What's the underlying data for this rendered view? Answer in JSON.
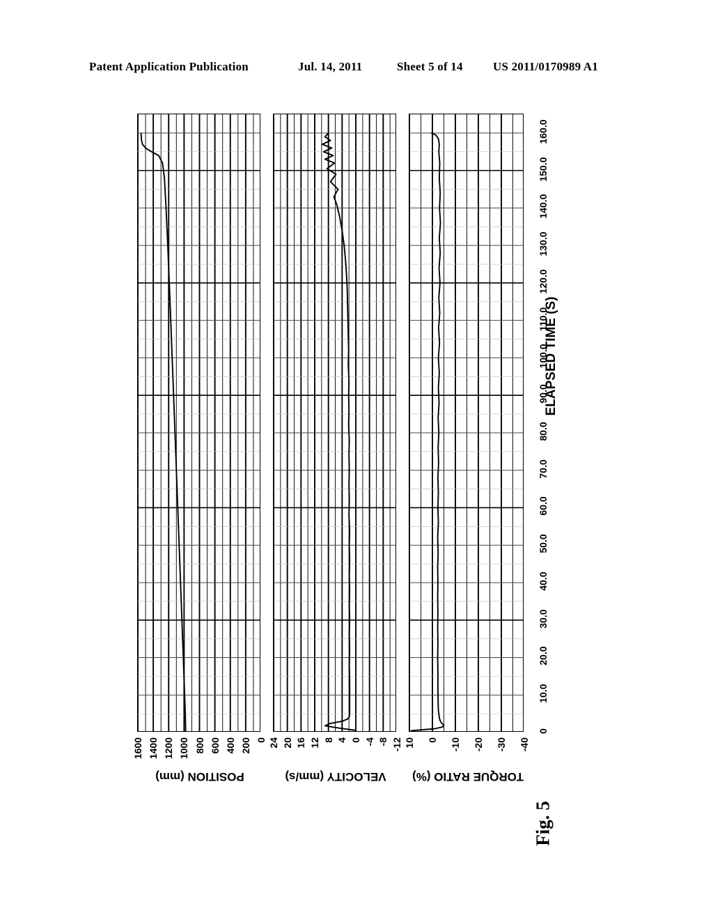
{
  "header": {
    "publication": "Patent Application Publication",
    "date": "Jul. 14, 2011",
    "sheet": "Sheet 5 of 14",
    "number": "US 2011/0170989 A1"
  },
  "figure": {
    "caption": "Fig. 5",
    "time_axis_title": "ELAPSED TIME (S)",
    "time_ticks": [
      "0",
      "10.0",
      "20.0",
      "30.0",
      "40.0",
      "50.0",
      "60.0",
      "70.0",
      "80.0",
      "90.0",
      "100.0",
      "110.0",
      "120.0",
      "130.0",
      "140.0",
      "150.0",
      "160.0"
    ]
  },
  "chart_data": [
    {
      "type": "line",
      "name": "position",
      "title": "POSITION (mm)",
      "xlabel": "ELAPSED TIME (S)",
      "ylabel": "POSITION (mm)",
      "orientation": "rotated-90",
      "grid": true,
      "xlim": [
        0,
        165
      ],
      "ylim": [
        0,
        1600
      ],
      "ytick_labels": [
        "1600",
        "1400",
        "1200",
        "1000",
        "800",
        "600",
        "400",
        "200",
        "0"
      ],
      "yticks": [
        1600,
        1400,
        1200,
        1000,
        800,
        600,
        400,
        200,
        0
      ],
      "minor_divisions_per_major": 2,
      "series": [
        {
          "name": "POSITION",
          "x": [
            0,
            1.0,
            2.0,
            3.0,
            4.0,
            6.0,
            10.0,
            20.0,
            30.0,
            40.0,
            50.0,
            60.0,
            70.0,
            80.0,
            90.0,
            100.0,
            110.0,
            120.0,
            130.0,
            140.0,
            148.0,
            152.0,
            154.0,
            155.0,
            156.0,
            157.0,
            158.0,
            159.0,
            160.0
          ],
          "y": [
            980,
            980,
            981,
            982,
            983,
            986,
            993,
            1010,
            1028,
            1046,
            1064,
            1082,
            1100,
            1118,
            1136,
            1155,
            1173,
            1192,
            1212,
            1234,
            1255,
            1280,
            1330,
            1420,
            1500,
            1540,
            1552,
            1556,
            1558
          ]
        }
      ]
    },
    {
      "type": "line",
      "name": "velocity",
      "title": "VELOCITY (mm/s)",
      "xlabel": "ELAPSED TIME (S)",
      "ylabel": "VELOCITY (mm/s)",
      "orientation": "rotated-90",
      "grid": true,
      "xlim": [
        0,
        165
      ],
      "ylim": [
        -12,
        24
      ],
      "ytick_labels": [
        "24",
        "20",
        "16",
        "12",
        "8",
        "4",
        "0",
        "-4",
        "-8",
        "-12"
      ],
      "yticks": [
        24,
        20,
        16,
        12,
        8,
        4,
        0,
        -4,
        -8,
        -12
      ],
      "minor_divisions_per_major": 2,
      "series": [
        {
          "name": "VELOCITY",
          "x": [
            0,
            0.6,
            1.2,
            1.8,
            2.4,
            3.0,
            3.6,
            4.2,
            5.0,
            6.0,
            8.0,
            10.0,
            14.0,
            18.0,
            22.0,
            26.0,
            30.0,
            34.0,
            38.0,
            42.0,
            46.0,
            50.0,
            54.0,
            58.0,
            62.0,
            66.0,
            70.0,
            74.0,
            78.0,
            82.0,
            86.0,
            90.0,
            94.0,
            98.0,
            102.0,
            106.0,
            110.0,
            114.0,
            118.0,
            122.0,
            126.0,
            130.0,
            134.0,
            138.0,
            141.0,
            143.0,
            145.0,
            147.0,
            149.0,
            150.5,
            152.0,
            153.0,
            154.0,
            155.0,
            156.0,
            157.0,
            158.0,
            159.0,
            160.0
          ],
          "y": [
            0,
            0.2,
            5.0,
            9.0,
            7.5,
            4.0,
            2.4,
            1.9,
            1.8,
            1.8,
            1.8,
            1.8,
            1.8,
            1.9,
            1.8,
            1.9,
            1.8,
            1.9,
            1.8,
            1.9,
            1.8,
            1.9,
            1.8,
            2.0,
            1.9,
            2.0,
            1.9,
            2.0,
            1.9,
            2.1,
            2.0,
            2.1,
            2.0,
            2.2,
            2.1,
            2.2,
            2.3,
            2.4,
            2.5,
            2.7,
            3.0,
            3.4,
            4.0,
            4.8,
            5.6,
            6.4,
            5.2,
            7.4,
            5.8,
            8.4,
            6.2,
            9.0,
            6.6,
            9.4,
            7.0,
            9.8,
            7.4,
            9.0,
            8.0
          ]
        }
      ]
    },
    {
      "type": "line",
      "name": "torque_ratio",
      "title": "TORQUE RATIO (%)",
      "xlabel": "ELAPSED TIME (S)",
      "ylabel": "TORQUE RATIO (%)",
      "orientation": "rotated-90",
      "grid": true,
      "xlim": [
        0,
        165
      ],
      "ylim": [
        -40,
        10
      ],
      "ytick_labels": [
        "10",
        "0",
        "-10",
        "-20",
        "-30",
        "-40"
      ],
      "yticks": [
        10,
        0,
        -10,
        -20,
        -30,
        -40
      ],
      "minor_divisions_per_major": 2,
      "series": [
        {
          "name": "TORQUE RATIO",
          "x": [
            0,
            0.5,
            1.0,
            1.5,
            2.0,
            2.5,
            3.0,
            3.5,
            4.0,
            5.0,
            6.0,
            8.0,
            12.0,
            16.0,
            20.0,
            24.0,
            28.0,
            32.0,
            36.0,
            40.0,
            44.0,
            48.0,
            52.0,
            56.0,
            60.0,
            64.0,
            68.0,
            72.0,
            76.0,
            80.0,
            84.0,
            88.0,
            92.0,
            96.0,
            100.0,
            104.0,
            108.0,
            112.0,
            116.0,
            120.0,
            124.0,
            128.0,
            132.0,
            136.0,
            140.0,
            144.0,
            148.0,
            152.0,
            155.0,
            157.0,
            158.5,
            159.5,
            160.0
          ],
          "y": [
            10,
            9.0,
            -1.0,
            -4.5,
            -5.0,
            -4.0,
            -3.5,
            -3.2,
            -3.0,
            -2.8,
            -2.6,
            -2.5,
            -2.4,
            -2.4,
            -2.3,
            -2.4,
            -2.3,
            -2.4,
            -2.3,
            -2.4,
            -2.3,
            -2.5,
            -2.3,
            -2.6,
            -2.4,
            -2.6,
            -2.4,
            -2.7,
            -2.5,
            -2.8,
            -2.5,
            -2.9,
            -2.6,
            -3.0,
            -2.6,
            -3.1,
            -2.7,
            -3.2,
            -2.8,
            -3.3,
            -2.9,
            -3.4,
            -3.0,
            -3.5,
            -3.1,
            -3.4,
            -3.0,
            -3.2,
            -2.8,
            -3.0,
            -2.6,
            -1.5,
            0.5
          ]
        }
      ]
    }
  ]
}
